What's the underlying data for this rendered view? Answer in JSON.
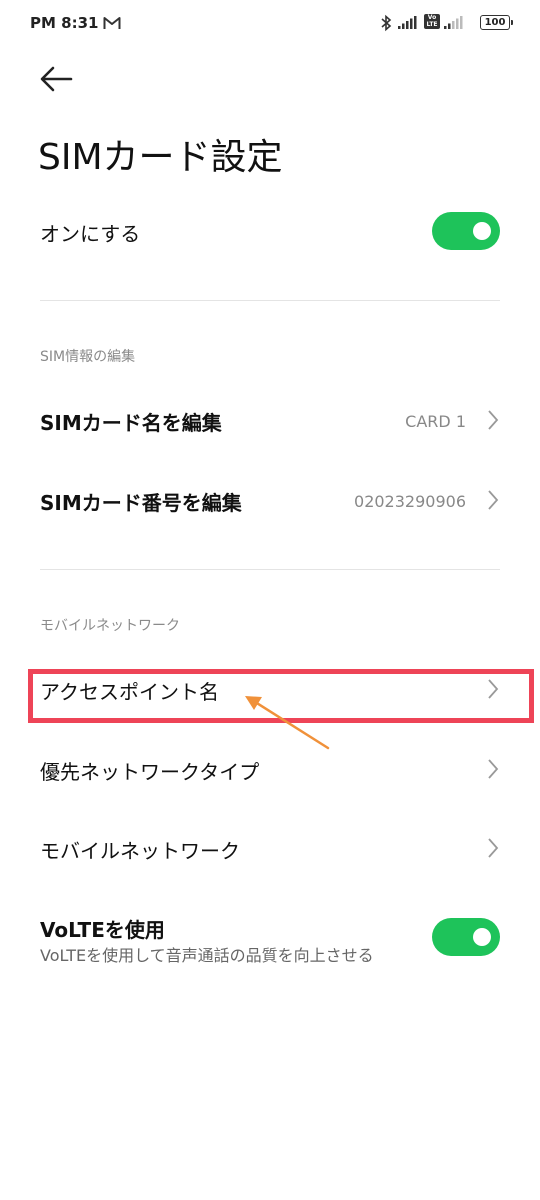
{
  "status_bar": {
    "time": "PM 8:31",
    "battery": "100",
    "volte_badge": "Vo LTE"
  },
  "header": {
    "title": "SIMカード設定"
  },
  "sim_toggle": {
    "label": "オンにする",
    "enabled": true
  },
  "sim_info_section": {
    "header": "SIM情報の編集",
    "items": [
      {
        "label": "SIMカード名を編集",
        "value": "CARD 1"
      },
      {
        "label": "SIMカード番号を編集",
        "value": "02023290906"
      }
    ]
  },
  "mobile_network_section": {
    "header": "モバイルネットワーク",
    "items": [
      {
        "label": "アクセスポイント名"
      },
      {
        "label": "優先ネットワークタイプ"
      },
      {
        "label": "モバイルネットワーク"
      }
    ]
  },
  "volte": {
    "label": "VoLTEを使用",
    "description": "VoLTEを使用して音声通話の品質を向上させる",
    "enabled": true
  },
  "colors": {
    "toggle_on": "#1ec35a",
    "highlight": "#ee4457",
    "arrow": "#f0913a"
  }
}
